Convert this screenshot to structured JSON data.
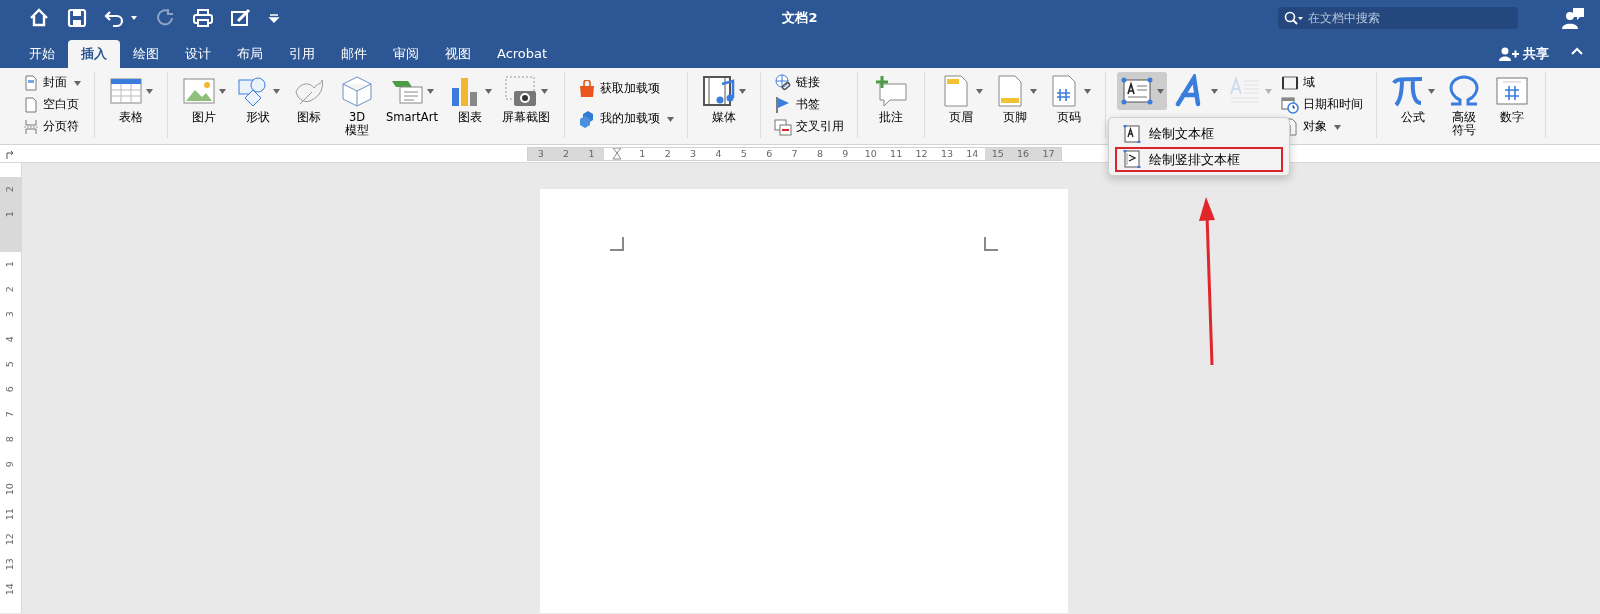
{
  "window": {
    "title": "文档2"
  },
  "search": {
    "placeholder": "在文档中搜索"
  },
  "tabs": [
    {
      "label": "开始",
      "selected": false
    },
    {
      "label": "插入",
      "selected": true
    },
    {
      "label": "绘图",
      "selected": false
    },
    {
      "label": "设计",
      "selected": false
    },
    {
      "label": "布局",
      "selected": false
    },
    {
      "label": "引用",
      "selected": false
    },
    {
      "label": "邮件",
      "selected": false
    },
    {
      "label": "审阅",
      "selected": false
    },
    {
      "label": "视图",
      "selected": false
    },
    {
      "label": "Acrobat",
      "selected": false
    }
  ],
  "share": {
    "label": "共享"
  },
  "ribbon_groups": [
    {
      "items": [
        {
          "kind": "stack",
          "items": [
            {
              "label": "封面",
              "dropdown": true
            },
            {
              "label": "空白页",
              "dropdown": false
            },
            {
              "label": "分页符",
              "dropdown": false
            }
          ]
        }
      ]
    },
    {
      "items": [
        {
          "kind": "large",
          "label": "表格",
          "dropdown": true
        }
      ]
    },
    {
      "items": [
        {
          "kind": "large",
          "label": "图片",
          "dropdown": true
        },
        {
          "kind": "large",
          "label": "形状",
          "dropdown": true
        },
        {
          "kind": "large",
          "label": "图标",
          "dropdown": false
        },
        {
          "kind": "large",
          "label": "3D\n模型",
          "dropdown": false
        },
        {
          "kind": "large",
          "label": "SmartArt",
          "dropdown": true
        },
        {
          "kind": "large",
          "label": "图表",
          "dropdown": true
        },
        {
          "kind": "large",
          "label": "屏幕截图",
          "dropdown": true
        }
      ]
    },
    {
      "items": [
        {
          "kind": "stack",
          "items": [
            {
              "label": "获取加载项",
              "dropdown": false
            },
            {
              "label": "我的加载项",
              "dropdown": true
            }
          ]
        }
      ]
    },
    {
      "items": [
        {
          "kind": "large",
          "label": "媒体",
          "dropdown": true
        }
      ]
    },
    {
      "items": [
        {
          "kind": "stack",
          "items": [
            {
              "label": "链接",
              "dropdown": false
            },
            {
              "label": "书签",
              "dropdown": false
            },
            {
              "label": "交叉引用",
              "dropdown": false
            }
          ]
        }
      ]
    },
    {
      "items": [
        {
          "kind": "large",
          "label": "批注",
          "dropdown": false
        }
      ]
    },
    {
      "items": [
        {
          "kind": "large",
          "label": "页眉",
          "dropdown": true
        },
        {
          "kind": "large",
          "label": "页脚",
          "dropdown": true
        },
        {
          "kind": "large",
          "label": "页码",
          "dropdown": true
        }
      ]
    },
    {
      "items": [
        {
          "kind": "large",
          "dropdown": true,
          "selected": true,
          "disabled": false
        },
        {
          "kind": "large",
          "dropdown": true,
          "selected": false,
          "disabled": false
        },
        {
          "kind": "large",
          "dropdown": true,
          "selected": false,
          "disabled": true
        },
        {
          "kind": "stack",
          "items": [
            {
              "label": "域",
              "dropdown": false
            },
            {
              "label": "日期和时间",
              "dropdown": false
            },
            {
              "label": "对象",
              "dropdown": true
            }
          ]
        }
      ]
    },
    {
      "items": [
        {
          "kind": "large",
          "label": "公式",
          "dropdown": true
        },
        {
          "kind": "large",
          "lines": [
            "高级",
            "符号"
          ],
          "dropdown": false
        },
        {
          "kind": "large",
          "label": "数字",
          "dropdown": false
        }
      ]
    }
  ],
  "ruler_h": {
    "labels": [
      "3",
      "2",
      "1",
      "1",
      "2",
      "3",
      "4",
      "5",
      "6",
      "7",
      "8",
      "9",
      "10",
      "11",
      "12",
      "13",
      "14",
      "15",
      "16",
      "17"
    ]
  },
  "ruler_v": {
    "labels": [
      "2",
      "1",
      "1",
      "2",
      "3",
      "4",
      "5",
      "6",
      "7",
      "8",
      "9",
      "10",
      "11",
      "12",
      "13",
      "14"
    ]
  },
  "dropdown_menu": {
    "items": [
      {
        "label": "绘制文本框",
        "highlighted": false
      },
      {
        "label": "绘制竖排文本框",
        "highlighted": true
      }
    ]
  }
}
